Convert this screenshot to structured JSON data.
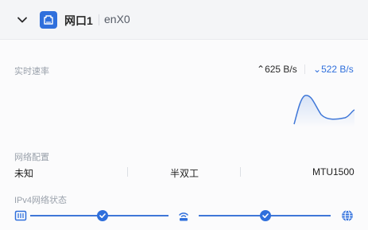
{
  "header": {
    "port_name": "网口1",
    "interface": "enX0"
  },
  "realtime": {
    "label": "实时速率",
    "upload": "625 B/s",
    "download": "522 B/s"
  },
  "config": {
    "label": "网络配置",
    "items": [
      "未知",
      "半双工",
      "MTU1500"
    ]
  },
  "ipv4": {
    "label": "IPv4网络状态"
  },
  "colors": {
    "accent": "#2f6fdc",
    "muted": "#9aa1ab"
  },
  "icons": [
    "chevron-down-icon",
    "ethernet-port-icon",
    "network-card-icon",
    "router-icon",
    "globe-icon",
    "check-icon"
  ]
}
